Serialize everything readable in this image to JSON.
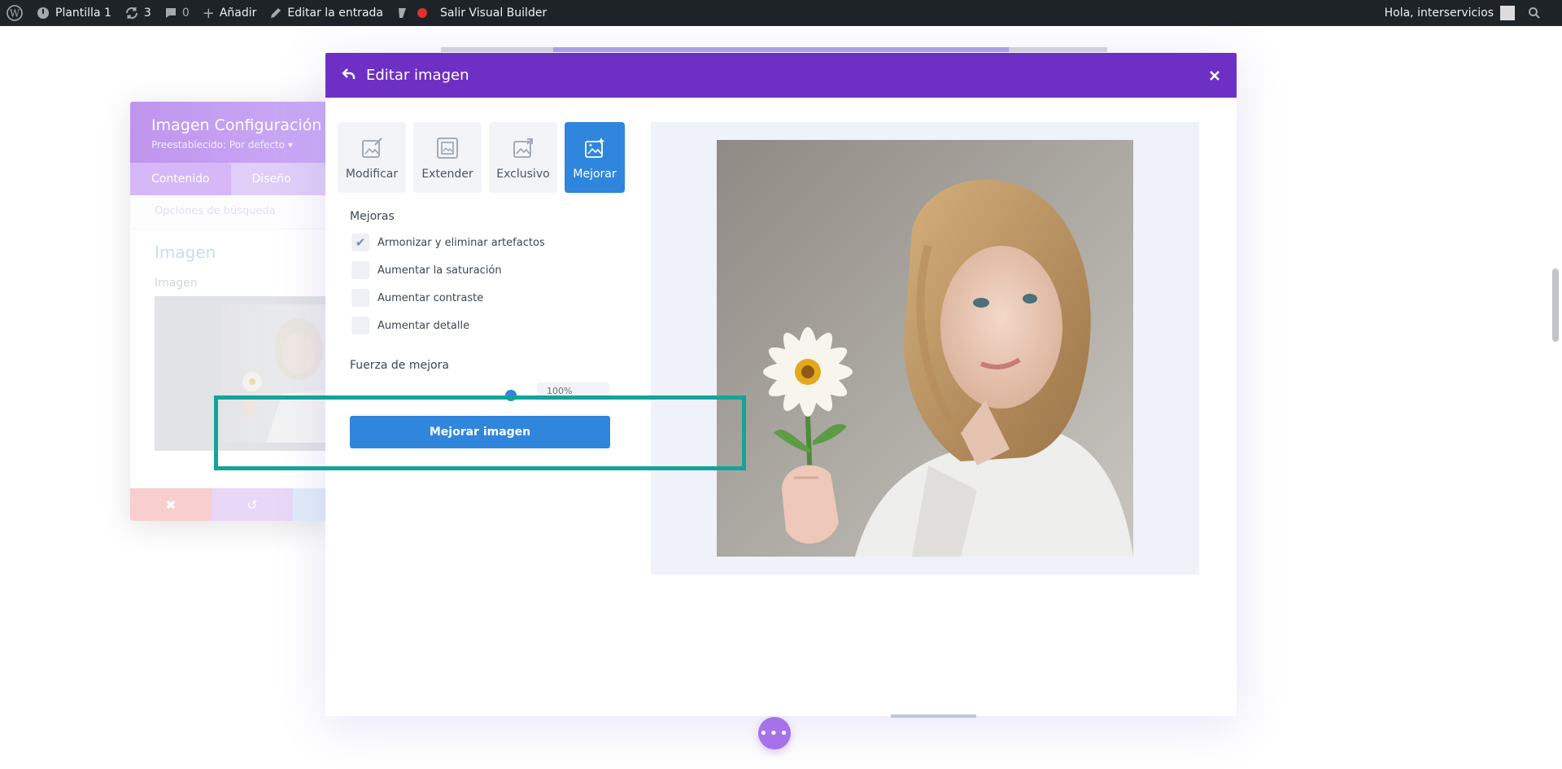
{
  "adminbar": {
    "site_name": "Plantilla 1",
    "updates_count": "3",
    "comments_count": "0",
    "add_label": "Añadir",
    "edit_label": "Editar la entrada",
    "exit_vb_label": "Salir Visual Builder",
    "greeting": "Hola, interservicios"
  },
  "settings_panel": {
    "title": "Imagen Configuración",
    "preset": "Preestablecido: Por defecto ▾",
    "tabs": [
      "Contenido",
      "Diseño"
    ],
    "search_placeholder": "Opciones de búsqueda",
    "section_title": "Imagen",
    "field_label": "Imagen"
  },
  "modal": {
    "title": "Editar imagen",
    "tools": [
      {
        "label": "Modificar",
        "icon": "modify-image-icon"
      },
      {
        "label": "Extender",
        "icon": "extend-image-icon"
      },
      {
        "label": "Exclusivo",
        "icon": "exclusive-image-icon"
      },
      {
        "label": "Mejorar",
        "icon": "enhance-image-icon",
        "active": true
      }
    ],
    "mejoras_title": "Mejoras",
    "checkboxes": [
      {
        "label": "Armonizar y eliminar artefactos",
        "checked": true
      },
      {
        "label": "Aumentar la saturación",
        "checked": false
      },
      {
        "label": "Aumentar contraste",
        "checked": false
      },
      {
        "label": "Aumentar detalle",
        "checked": false
      }
    ],
    "strength_label": "Fuerza de mejora",
    "strength_value": "100%",
    "strength_fraction": 1.0,
    "enhance_button": "Mejorar imagen"
  },
  "colors": {
    "modal_header": "#6e2fc4",
    "primary": "#2f86dc",
    "highlight": "#14a39a"
  }
}
